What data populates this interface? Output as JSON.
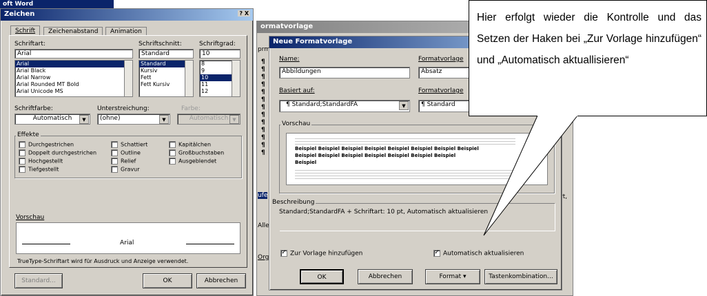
{
  "left_dialog": {
    "app_title": "oft Word",
    "title": "Zeichen",
    "title_controls": "? X",
    "tabs": [
      "Schrift",
      "Zeichenabstand",
      "Animation"
    ],
    "font_label": "Schriftart:",
    "font_value": "Arial",
    "font_list": [
      "Arial",
      "Arial Black",
      "Arial Narrow",
      "Arial Rounded MT Bold",
      "Arial Unicode MS"
    ],
    "style_label": "Schriftschnitt:",
    "style_value": "Standard",
    "style_list": [
      "Standard",
      "Kursiv",
      "Fett",
      "Fett Kursiv"
    ],
    "size_label": "Schriftgrad:",
    "size_value": "10",
    "size_list": [
      "8",
      "9",
      "10",
      "11",
      "12"
    ],
    "color_label": "Schriftfarbe:",
    "color_value": "Automatisch",
    "underline_label": "Unterstreichung:",
    "underline_value": "(ohne)",
    "ucolor_label": "Farbe:",
    "ucolor_value": "Automatisch",
    "effects_label": "Effekte",
    "effects": [
      "Durchgestrichen",
      "Doppelt durchgestrichen",
      "Hochgestellt",
      "Tiefgestellt",
      "Schattiert",
      "Outline",
      "Relief",
      "Gravur",
      "Kapitälchen",
      "Großbuchstaben",
      "Ausgeblendet"
    ],
    "preview_label": "Vorschau",
    "preview_text": "Arial",
    "info_text": "TrueType-Schriftart wird für Ausdruck und Anzeige verwendet.",
    "btn_default": "Standard...",
    "btn_ok": "OK",
    "btn_cancel": "Abbrechen"
  },
  "right_dialog": {
    "bg_title": "ormatvorlage",
    "title": "Neue Formatvorlage",
    "name_label": "Name:",
    "name_value": "Abbildungen",
    "type_label": "Formatvorlage",
    "type_value": "Absatz",
    "based_label": "Basiert auf:",
    "based_value": "¶ Standard;StandardFA",
    "next_label": "Formatvorlage",
    "next_value": "¶ Standard",
    "preview_label": "Vorschau",
    "sample_word": "Beispiel",
    "desc_label": "Beschreibung",
    "desc_text": "Standard;StandardFA + Schriftart: 10 pt, Automatisch aktualisieren",
    "cb_add": "Zur Vorlage hinzufügen",
    "cb_auto": "Automatisch aktualisieren",
    "btn_ok": "OK",
    "btn_cancel": "Abbrechen",
    "btn_format": "Format ▾",
    "btn_keys": "Tastenkombination...",
    "bg_side": "prm",
    "bg_ort": "rt,",
    "bg_alle": "Alle",
    "bg_org": "Org",
    "bg_ufe": "ufe"
  },
  "callout": {
    "text": "Hier erfolgt wieder die Kontrolle und das Setzen der Haken bei „Zur Vorlage hinzufügen“ und „Automatisch aktuallisieren“"
  }
}
